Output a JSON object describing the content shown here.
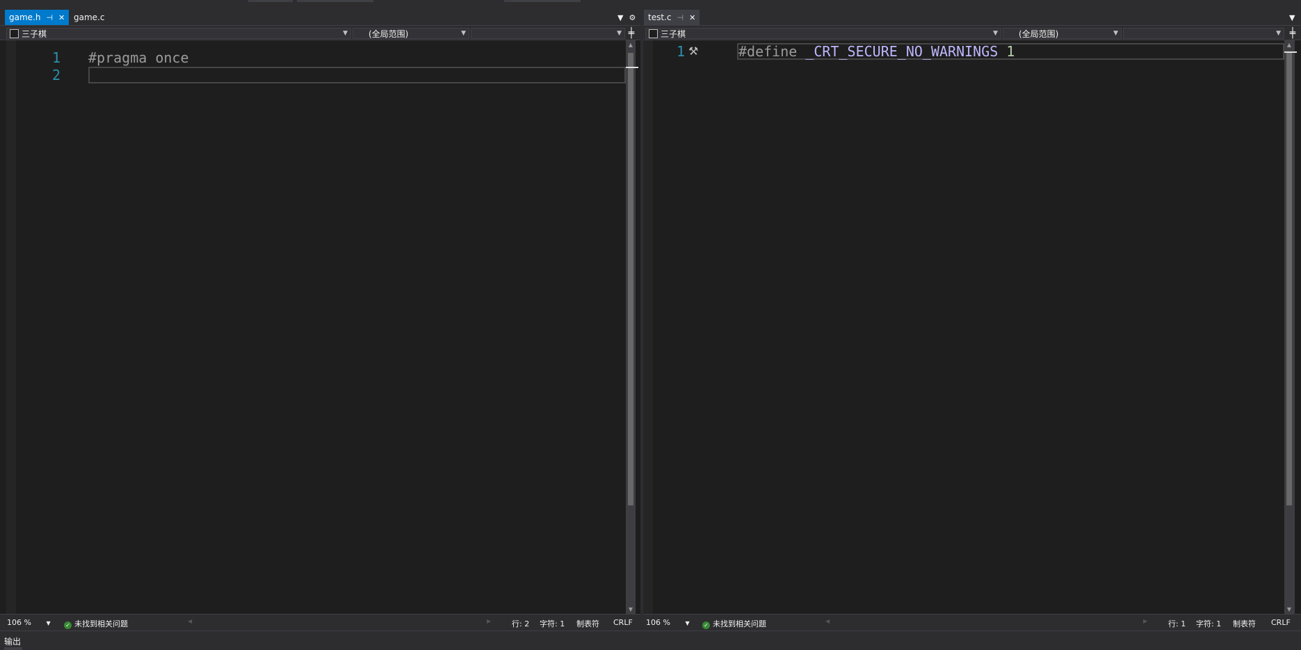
{
  "colors": {
    "accent": "#007acc",
    "line_number": "#2b91af",
    "preprocessor": "#9b9b9b",
    "macro": "#beb7ff",
    "number": "#b5cea8",
    "ok": "#388a34"
  },
  "left_pane": {
    "tabs": [
      {
        "label": "game.h",
        "active": true
      },
      {
        "label": "game.c",
        "active": false
      }
    ],
    "nav": {
      "project": "三子棋",
      "scope": "(全局范围)",
      "member": ""
    },
    "lines": [
      {
        "number": "1",
        "code": "#pragma once"
      },
      {
        "number": "2",
        "code": ""
      }
    ],
    "status": {
      "zoom": "106 %",
      "issues": "未找到相关问题",
      "row": "行: 2",
      "col": "字符: 1",
      "tabs": "制表符",
      "eol": "CRLF"
    }
  },
  "right_pane": {
    "tabs": [
      {
        "label": "test.c",
        "active": false
      }
    ],
    "nav": {
      "project": "三子棋",
      "scope": "(全局范围)",
      "member": ""
    },
    "lines": [
      {
        "number": "1",
        "directive": "#define",
        "macro": "_CRT_SECURE_NO_WARNINGS",
        "value": "1"
      }
    ],
    "status": {
      "zoom": "106 %",
      "issues": "未找到相关问题",
      "row": "行: 1",
      "col": "字符: 1",
      "tabs": "制表符",
      "eol": "CRLF"
    }
  },
  "output_panel": {
    "label": "输出"
  },
  "icons": {
    "pin": "pin-icon",
    "close": "close-icon",
    "dropdown": "chevron-down-icon",
    "settings": "gear-icon",
    "split": "split-icon",
    "ok": "check-circle-icon",
    "quick_action": "screwdriver-icon"
  }
}
